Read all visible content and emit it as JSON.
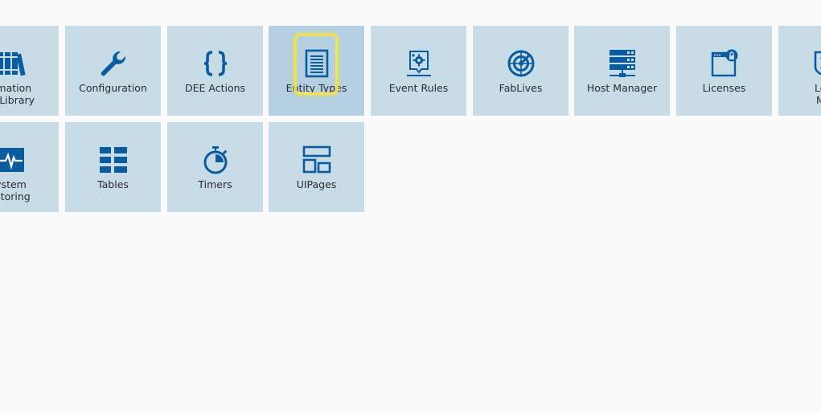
{
  "colors": {
    "page_background": "#f9f9f9",
    "tile_background": "#c8dce8",
    "tile_selected_background": "#b4d0e2",
    "icon_blue": "#0b5c9e",
    "highlight": "#f4e34a",
    "label_text": "#2c2c2c"
  },
  "tiles": [
    {
      "label": "omation\nts Library",
      "icon": "books-icon"
    },
    {
      "label": "Configuration",
      "icon": "wrench-icon"
    },
    {
      "label": "DEE Actions",
      "icon": "curly-braces-icon"
    },
    {
      "label": "Entity Types",
      "icon": "document-lines-icon",
      "selected": true
    },
    {
      "label": "Event Rules",
      "icon": "event-gear-icon"
    },
    {
      "label": "FabLives",
      "icon": "radar-icon"
    },
    {
      "label": "Host Manager",
      "icon": "server-stack-icon"
    },
    {
      "label": "Licenses",
      "icon": "license-window-lock-icon"
    },
    {
      "label": "Loca\nMes",
      "icon": "localized-messages-icon"
    },
    {
      "label": "ystem\nnitoring",
      "icon": "pulse-monitor-icon"
    },
    {
      "label": "Tables",
      "icon": "table-grid-icon"
    },
    {
      "label": "Timers",
      "icon": "stopwatch-icon"
    },
    {
      "label": "UIPages",
      "icon": "page-layout-icon"
    }
  ]
}
